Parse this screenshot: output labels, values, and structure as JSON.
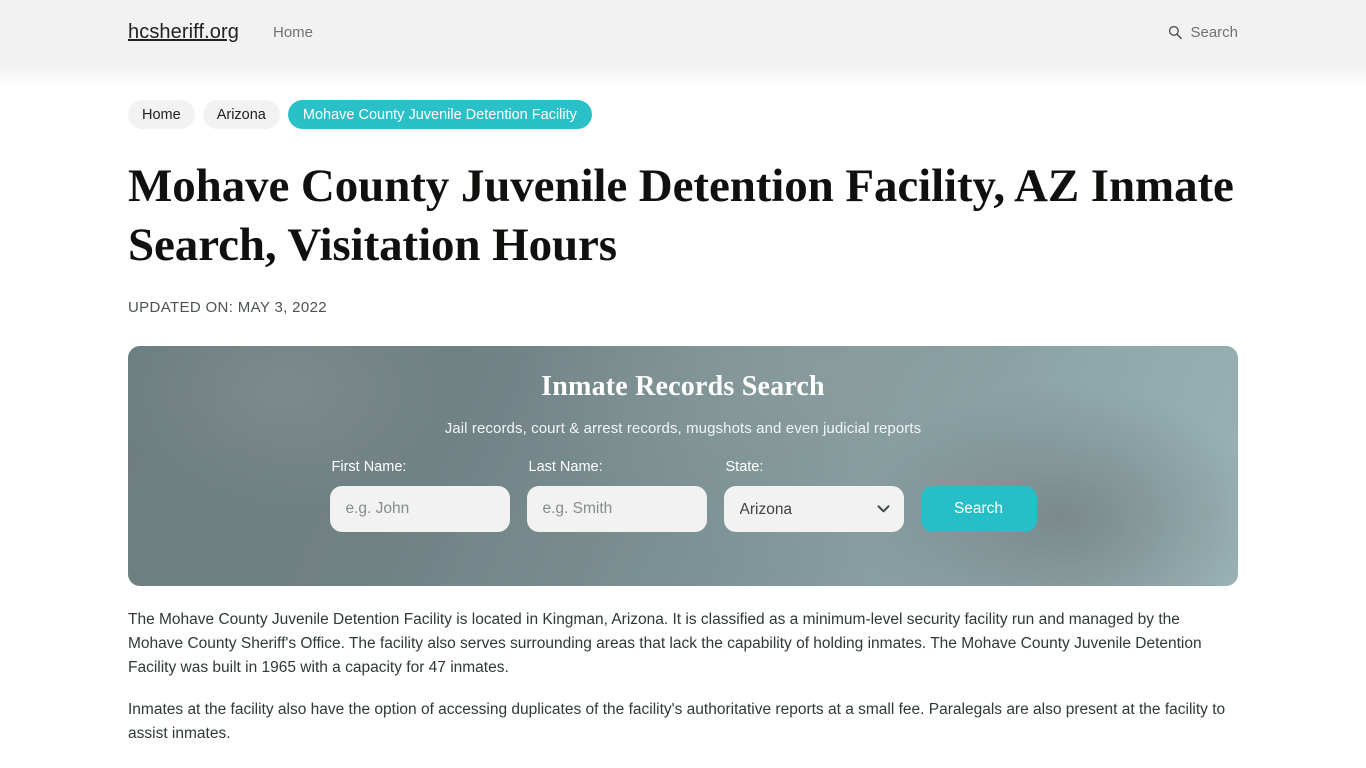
{
  "header": {
    "brand": "hcsheriff.org",
    "nav": [
      {
        "label": "Home"
      }
    ],
    "search": {
      "icon": "search-icon",
      "label": "Search"
    }
  },
  "breadcrumb": [
    {
      "label": "Home",
      "active": false
    },
    {
      "label": "Arizona",
      "active": false
    },
    {
      "label": "Mohave County Juvenile Detention Facility",
      "active": true
    }
  ],
  "title": "Mohave County Juvenile Detention Facility, AZ Inmate Search, Visitation Hours",
  "updated_on": "UPDATED ON: MAY 3, 2022",
  "search_panel": {
    "title": "Inmate Records Search",
    "subtitle": "Jail records, court & arrest records, mugshots and even judicial reports",
    "fields": {
      "first_name": {
        "label": "First Name:",
        "placeholder": "e.g. John",
        "value": ""
      },
      "last_name": {
        "label": "Last Name:",
        "placeholder": "e.g. Smith",
        "value": ""
      },
      "state": {
        "label": "State:",
        "selected": "Arizona",
        "options": [
          "Arizona"
        ],
        "chevron_icon": "chevron-down-icon"
      }
    },
    "submit_label": "Search"
  },
  "article": {
    "paragraphs": [
      "The Mohave County Juvenile Detention Facility is located in Kingman, Arizona. It is classified as a minimum-level security facility run and managed by the Mohave County Sheriff's Office. The facility also serves surrounding areas that lack the capability of holding inmates. The Mohave County Juvenile Detention Facility was built in 1965 with a capacity for 47 inmates.",
      "Inmates at the facility also have the option of accessing duplicates of the facility's authoritative reports at a small fee. Paralegals are also present at the facility to assist inmates."
    ]
  },
  "colors": {
    "accent_teal": "#2ac0c8",
    "header_bg": "#f2f2f3",
    "panel_base": "#7e9496",
    "text_dark": "#10100f",
    "text_muted": "#6f7276"
  }
}
